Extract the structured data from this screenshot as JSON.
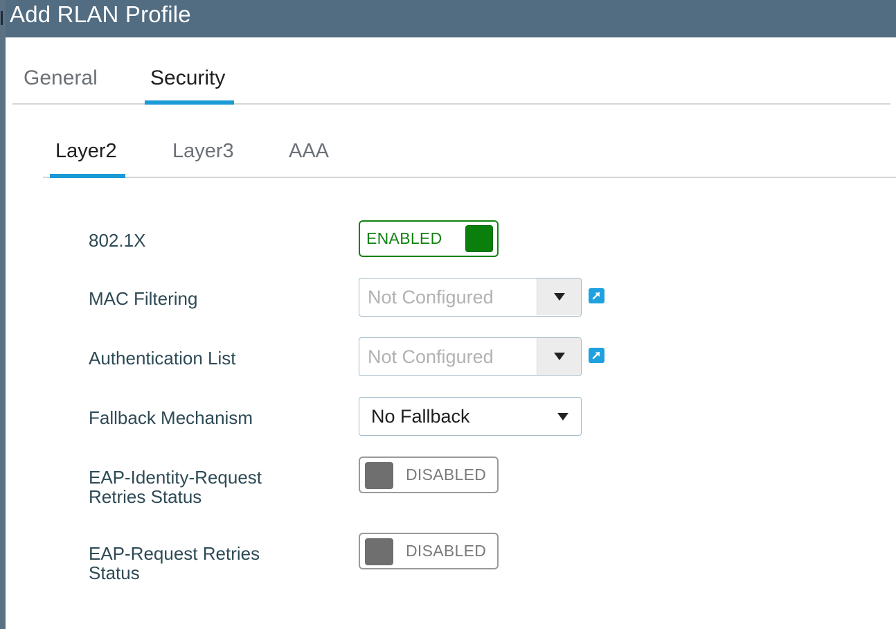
{
  "header": {
    "title": "Add RLAN Profile"
  },
  "main_tabs": [
    {
      "label": "General",
      "active": false
    },
    {
      "label": "Security",
      "active": true
    }
  ],
  "sub_tabs": [
    {
      "label": "Layer2",
      "active": true
    },
    {
      "label": "Layer3",
      "active": false
    },
    {
      "label": "AAA",
      "active": false
    }
  ],
  "fields": {
    "dot1x": {
      "label": "802.1X",
      "state": "ENABLED"
    },
    "mac_filtering": {
      "label": "MAC Filtering",
      "value": "Not Configured",
      "icon": "external-link-icon"
    },
    "auth_list": {
      "label": "Authentication List",
      "value": "Not Configured",
      "icon": "external-link-icon"
    },
    "fallback": {
      "label": "Fallback Mechanism",
      "value": "No Fallback"
    },
    "eap_identity": {
      "label_line1": "EAP-Identity-Request",
      "label_line2": "Retries Status",
      "state": "DISABLED"
    },
    "eap_request": {
      "label_line1": "EAP-Request Retries",
      "label_line2": "Status",
      "state": "DISABLED"
    }
  },
  "colors": {
    "header_bg": "#526c81",
    "accent": "#1b9ad6",
    "enabled_green": "#128212",
    "disabled_gray": "#6f6f6f",
    "label_text": "#2d4a55"
  }
}
